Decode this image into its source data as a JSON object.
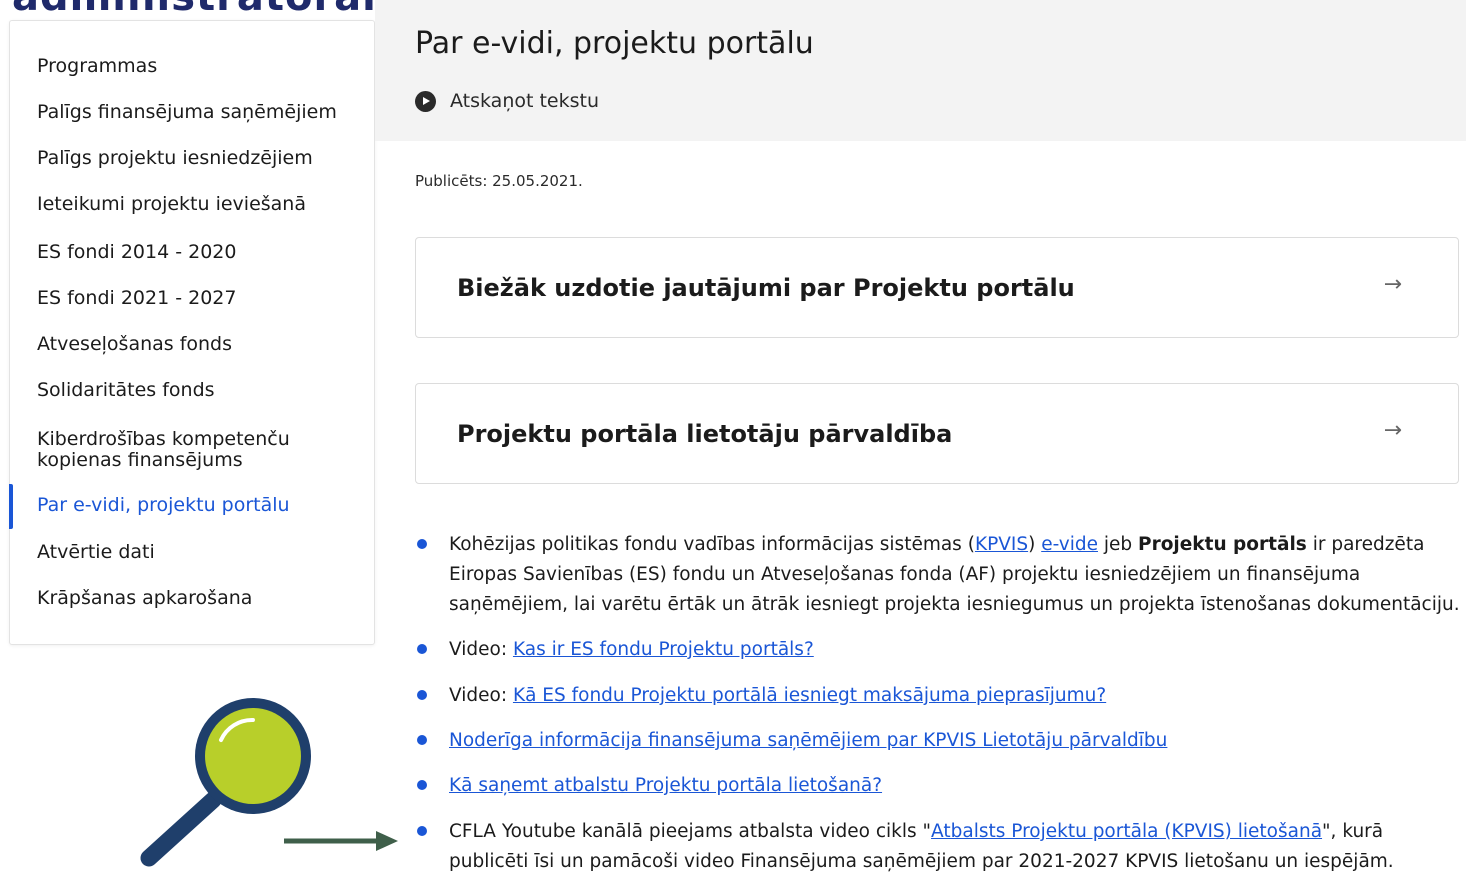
{
  "page": {
    "cut_heading": "administratoram",
    "title": "Par e-vidi, projektu portālu",
    "listen_label": "Atskaņot tekstu",
    "published": "Publicēts: 25.05.2021."
  },
  "sidebar": {
    "items": [
      {
        "label": "Programmas"
      },
      {
        "label": "Palīgs finansējuma saņēmējiem"
      },
      {
        "label": "Palīgs projektu iesniedzējiem"
      },
      {
        "label": "Ieteikumi projektu ieviešanā"
      },
      {
        "label": "ES fondi 2014 - 2020"
      },
      {
        "label": "ES fondi 2021 - 2027"
      },
      {
        "label": "Atveseļošanas fonds"
      },
      {
        "label": "Solidaritātes fonds"
      },
      {
        "label": "Kiberdrošības kompetenču kopienas finansējums"
      },
      {
        "label": "Par e-vidi, projektu portālu",
        "active": true
      },
      {
        "label": "Atvērtie dati"
      },
      {
        "label": "Krāpšanas apkarošana"
      }
    ]
  },
  "cards": [
    {
      "title": "Biežāk uzdotie jautājumi par Projektu portālu",
      "arrow": "→"
    },
    {
      "title": "Projektu portāla lietotāju pārvaldība",
      "arrow": "→"
    }
  ],
  "bullets": {
    "b1": {
      "t1": "Kohēzijas politikas fondu vadības informācijas sistēmas (",
      "link1": "KPVIS",
      "t2": ") ",
      "link2": "e-vide",
      "t3": " jeb ",
      "bold": "Projektu portāls",
      "t4": " ir paredzēta Eiropas Savienības (ES) fondu un Atveseļošanas fonda (AF) projektu iesniedzējiem un finansējuma saņēmējiem, lai varētu ērtāk un ātrāk iesniegt projekta iesniegumus un projekta īstenošanas dokumentāciju."
    },
    "b2": {
      "prefix": "Video: ",
      "link": "Kas ir ES fondu Projektu portāls?"
    },
    "b3": {
      "prefix": "Video: ",
      "link": "Kā ES fondu Projektu portālā iesniegt maksājuma pieprasījumu?"
    },
    "b4": {
      "link": "Noderīga informācija finansējuma saņēmējiem par KPVIS Lietotāju pārvaldību"
    },
    "b5": {
      "link": "Kā saņemt atbalstu Projektu portāla lietošanā?"
    },
    "b6": {
      "t1": "CFLA Youtube kanālā pieejams atbalsta video cikls \"",
      "link": "Atbalsts Projektu portāla (KPVIS) lietošanā",
      "t2": "\", kurā publicēti īsi un pamācoši video Finansējuma saņēmējiem par 2021-2027 KPVIS lietošanu un iespējām."
    }
  },
  "colors": {
    "accent": "#1a56d6",
    "header_band": "#f3f3f3",
    "magnifier_lens": "#b8cf2a",
    "magnifier_frame": "#1f3f6b",
    "arrow": "#3f5f4a"
  },
  "icons": {
    "listen": "play-circle-icon",
    "card_arrow": "arrow-right-icon",
    "magnifier": "magnifying-glass-icon"
  }
}
